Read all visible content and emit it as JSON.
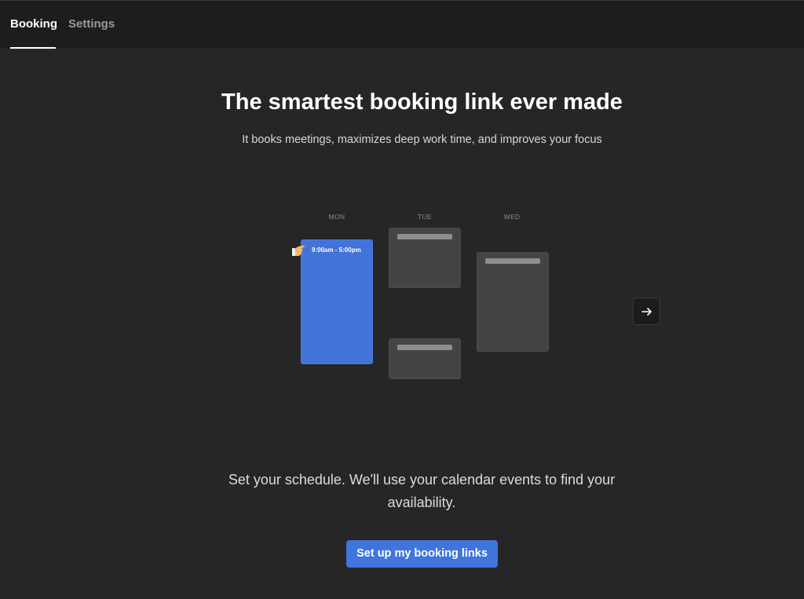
{
  "tabs": [
    {
      "label": "Booking",
      "active": true
    },
    {
      "label": "Settings",
      "active": false
    }
  ],
  "hero": {
    "title": "The smartest booking link ever made",
    "subtitle": "It books meetings, maximizes deep work time, and improves your focus"
  },
  "calendar": {
    "days": [
      "MON",
      "TUE",
      "WED"
    ],
    "blue_block_time": "9:00am - 5:00pm"
  },
  "body_text": "Set your schedule. We'll use your calendar events to find your availability.",
  "cta_label": "Set up my booking links",
  "icons": {
    "next": "arrow-right-icon",
    "hand": "hand-pointer-icon"
  },
  "colors": {
    "background": "#262626",
    "topbar": "#1d1d1d",
    "accent_blue": "#3f75dc",
    "event_block": "#444444"
  }
}
